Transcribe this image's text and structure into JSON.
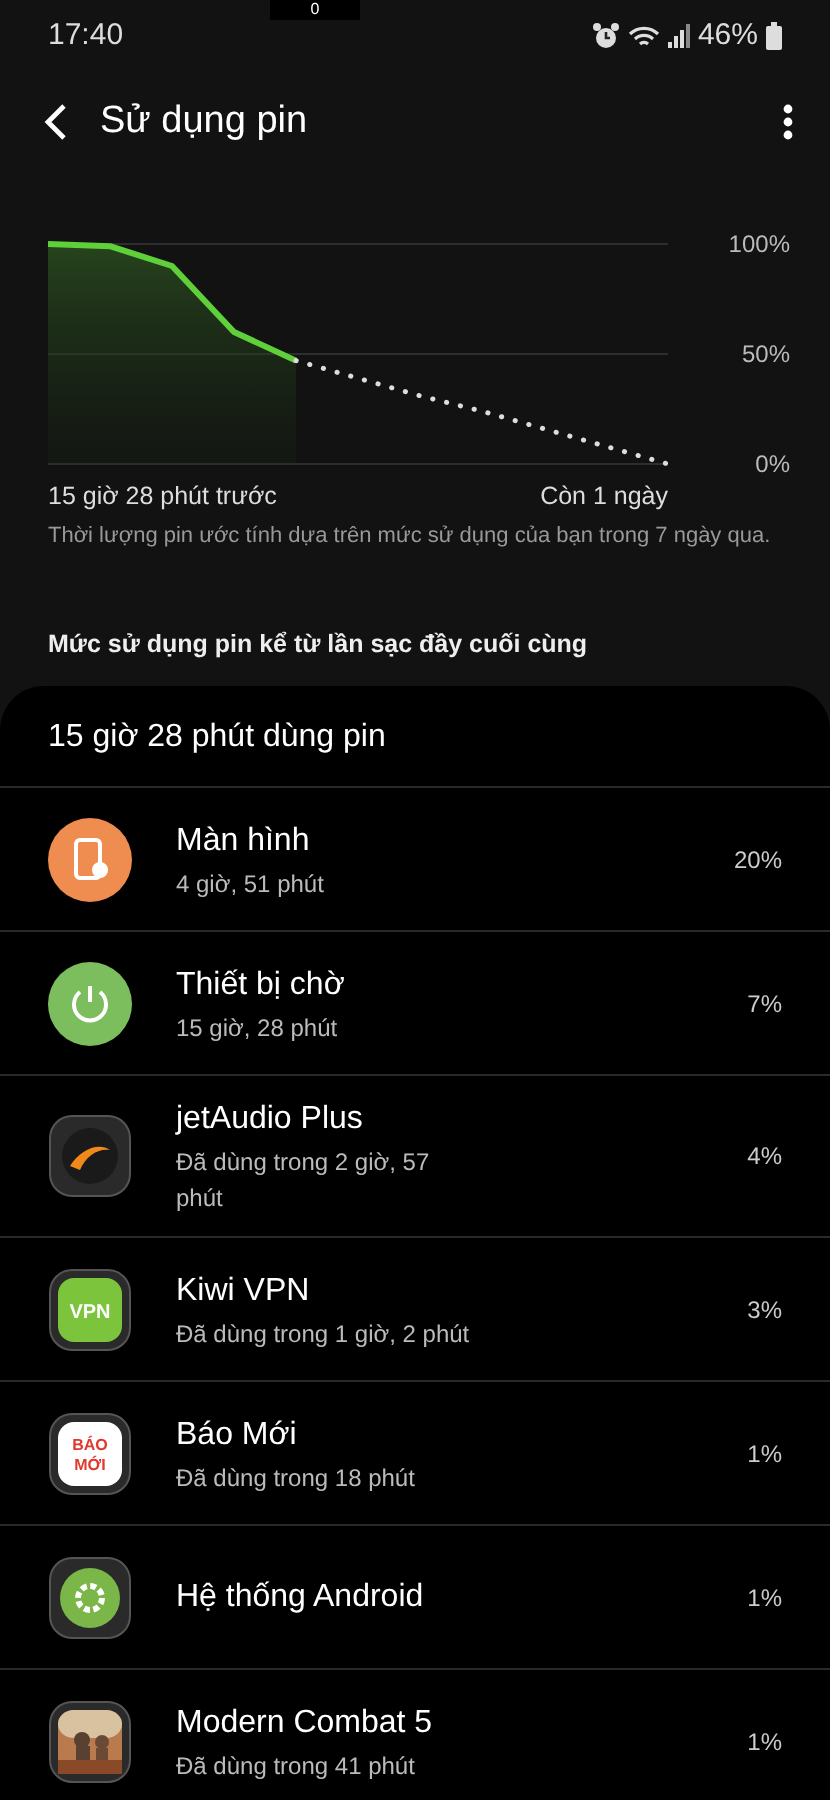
{
  "status_bar": {
    "time": "17:40",
    "notch_label": "0",
    "battery": "46%"
  },
  "header": {
    "title": "Sử dụng pin"
  },
  "chart": {
    "start_label": "15 giờ 28 phút trước",
    "end_label": "Còn 1 ngày",
    "chart_data": {
      "type": "line",
      "categories": [
        null,
        null,
        null,
        null,
        null,
        null,
        null,
        null,
        null,
        null,
        null
      ],
      "ylim": [
        0,
        100
      ],
      "series": [
        {
          "color": "#5fcf3a",
          "values": [
            100,
            99,
            90,
            60,
            47,
            null,
            null,
            null,
            null,
            null,
            null
          ]
        },
        {
          "color": "#dddddd",
          "line_style": "dotted",
          "values": [
            null,
            null,
            null,
            null,
            47,
            39,
            31,
            24,
            16,
            8,
            0
          ]
        }
      ],
      "yticks": [
        {
          "value": 0,
          "label": "0%"
        },
        {
          "value": 50,
          "label": "50%"
        },
        {
          "value": 100,
          "label": "100%"
        }
      ]
    }
  },
  "note": "Thời lượng pin ước tính dựa trên mức sử dụng của bạn trong 7 ngày qua.",
  "section_title": "Mức sử dụng pin kể từ lần sạc đầy cuối cùng",
  "usage": {
    "total": "15 giờ 28 phút dùng pin",
    "items": [
      {
        "kind": "screen",
        "name": "Màn hình",
        "detail": "4 giờ, 51 phút",
        "percent": "20%"
      },
      {
        "kind": "standby",
        "name": "Thiết bị chờ",
        "detail": "15 giờ, 28 phút",
        "percent": "7%"
      },
      {
        "kind": "jetaudio",
        "name": "jetAudio Plus",
        "detail": "Đã dùng trong 2 giờ, 57 phút",
        "percent": "4%"
      },
      {
        "kind": "vpn",
        "name": "Kiwi VPN",
        "detail": "Đã dùng trong 1 giờ, 2 phút",
        "percent": "3%",
        "icon_text": "VPN"
      },
      {
        "kind": "news",
        "name": "Báo Mới",
        "detail": "Đã dùng trong 18 phút",
        "percent": "1%",
        "icon_text": "BÁO MỚI"
      },
      {
        "kind": "android",
        "name": "Hệ thống Android",
        "percent": "1%"
      },
      {
        "kind": "game",
        "name": "Modern Combat 5",
        "detail": "Đã dùng trong 41 phút",
        "percent": "1%"
      }
    ]
  }
}
